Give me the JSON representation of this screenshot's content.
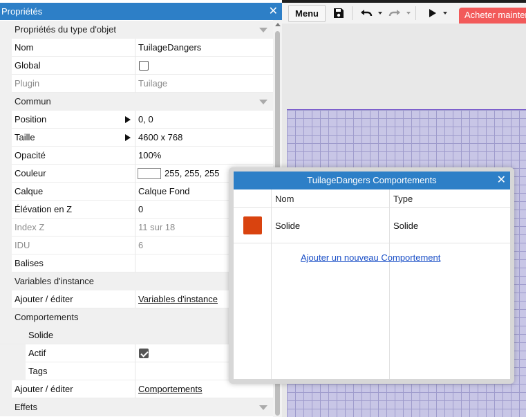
{
  "panel": {
    "title": "Propriétés",
    "close_glyph": "✕",
    "sections": {
      "object_type": "Propriétés du type d'objet",
      "common": "Commun",
      "instance_variables": "Variables d'instance",
      "behaviors": "Comportements",
      "effects": "Effets"
    },
    "rows": {
      "name": {
        "label": "Nom",
        "value": "TuilageDangers"
      },
      "global": {
        "label": "Global",
        "checked": false
      },
      "plugin": {
        "label": "Plugin",
        "value": "Tuilage"
      },
      "position": {
        "label": "Position",
        "value": "0, 0"
      },
      "size": {
        "label": "Taille",
        "value": "4600 x 768"
      },
      "opacity": {
        "label": "Opacité",
        "value": "100%"
      },
      "color": {
        "label": "Couleur",
        "value": "255, 255, 255",
        "swatch": "#ffffff"
      },
      "layer": {
        "label": "Calque",
        "value": "Calque Fond"
      },
      "z_elevation": {
        "label": "Élévation en Z",
        "value": "0"
      },
      "z_index": {
        "label": "Index Z",
        "value": "11 sur 18"
      },
      "uid": {
        "label": "IDU",
        "value": "6"
      },
      "tags": {
        "label": "Balises",
        "value": ""
      },
      "instvars_edit": {
        "label": "Ajouter / éditer",
        "link": "Variables d'instance"
      },
      "behavior_solid": {
        "label": "Solide"
      },
      "behavior_enabled": {
        "label": "Actif",
        "checked": true
      },
      "behavior_tags": {
        "label": "Tags",
        "value": ""
      },
      "behaviors_edit": {
        "label": "Ajouter / éditer",
        "link": "Comportements"
      }
    }
  },
  "toolbar": {
    "menu_label": "Menu",
    "save_icon": "floppy-icon",
    "undo_icon": "undo-icon",
    "redo_icon": "redo-icon",
    "play_icon": "play-icon",
    "buy_label": "Acheter maintenant",
    "buy_color": "#f25a5a"
  },
  "dialog": {
    "title": "TuilageDangers Comportements",
    "close_glyph": "✕",
    "columns": {
      "name": "Nom",
      "type": "Type"
    },
    "behaviors": [
      {
        "name": "Solide",
        "type": "Solide",
        "color": "#d9430f"
      }
    ],
    "add_link": "Ajouter un nouveau Comportement"
  },
  "colors": {
    "accent": "#2d7fc7",
    "canvas": "#c8c6e6",
    "grid": "#9e9bcc"
  }
}
